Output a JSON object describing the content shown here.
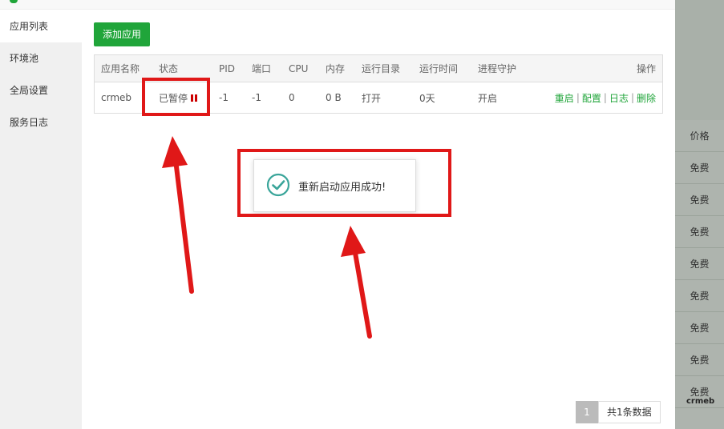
{
  "background": {
    "column_header": "价格",
    "rows": [
      "免费",
      "免费",
      "免费",
      "免费",
      "免费",
      "免费",
      "免费",
      "免费"
    ],
    "logo_text": "crmeb"
  },
  "sidebar": {
    "items": [
      {
        "label": "应用列表",
        "active": true
      },
      {
        "label": "环境池",
        "active": false
      },
      {
        "label": "全局设置",
        "active": false
      },
      {
        "label": "服务日志",
        "active": false
      }
    ]
  },
  "toolbar": {
    "add_label": "添加应用"
  },
  "table": {
    "headers": [
      "应用名称",
      "状态",
      "PID",
      "端口",
      "CPU",
      "内存",
      "运行目录",
      "运行时间",
      "进程守护",
      "操作"
    ],
    "rows": [
      {
        "name": "crmeb",
        "status": "已暂停",
        "pid": "-1",
        "port": "-1",
        "cpu": "0",
        "memory": "0 B",
        "dir": "打开",
        "uptime": "0天",
        "daemon": "开启",
        "actions": [
          "重启",
          "配置",
          "日志",
          "删除"
        ],
        "action_sep": "|"
      }
    ]
  },
  "toast": {
    "message": "重新启动应用成功!"
  },
  "pagination": {
    "current": "1",
    "total_text": "共1条数据"
  },
  "colors": {
    "accent": "#20a53a",
    "paused": "#cc0000",
    "annotation": "#e01818"
  }
}
